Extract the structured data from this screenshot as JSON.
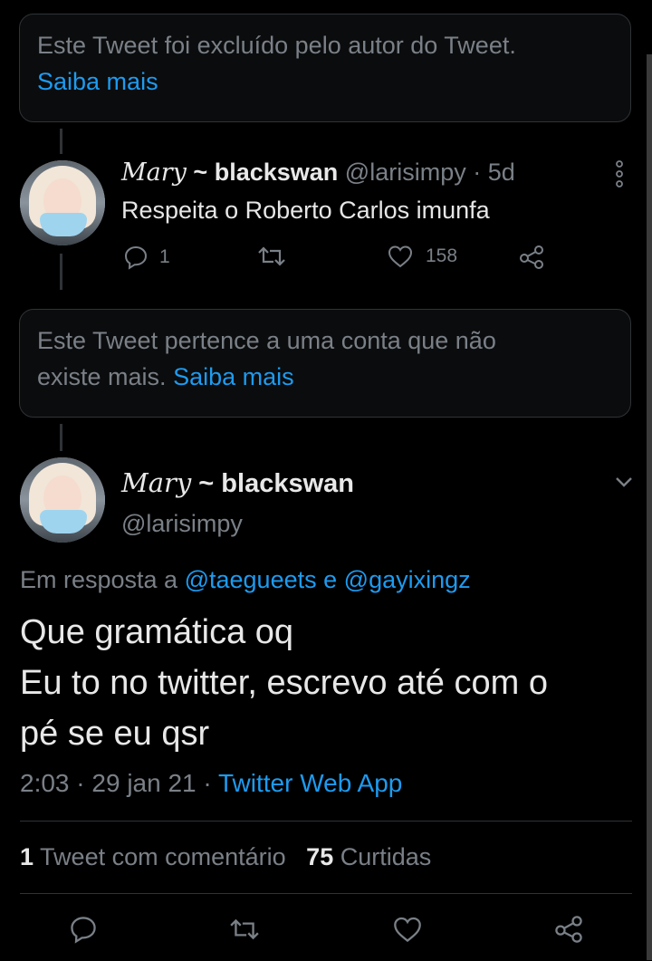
{
  "notices": {
    "deleted": {
      "text": "Este Tweet foi excluído pelo autor do Tweet.",
      "link": "Saiba mais"
    },
    "suspended": {
      "text_line1": "Este Tweet pertence a uma conta que não",
      "text_line2": "existe mais.",
      "link": "Saiba mais"
    }
  },
  "reply_tweet": {
    "display_name": "Mary",
    "display_name_bold": "blackswan",
    "handle": "@larisimpy",
    "separator": "·",
    "time": "5d",
    "text": "Respeita o Roberto Carlos imunfa",
    "reply_count": "1",
    "retweet_count": "",
    "like_count": "158"
  },
  "main_tweet": {
    "display_name": "Mary",
    "display_name_bold": "blackswan",
    "handle": "@larisimpy",
    "reply_prefix": "Em resposta a",
    "reply_user1": "@taegueets",
    "reply_conj": "e",
    "reply_user2": "@gayixingz",
    "text_lines": [
      "Que gramática oq",
      "Eu to no twitter, escrevo até com o",
      "pé se eu qsr"
    ],
    "time": "2:03",
    "sep1": "·",
    "date": "29 jan 21",
    "sep2": "·",
    "source": "Twitter Web App",
    "quote_count": "1",
    "quote_label": "Tweet com comentário",
    "like_count": "75",
    "like_label": "Curtidas"
  },
  "icons": {
    "reply": "reply-icon",
    "retweet": "retweet-icon",
    "like": "heart-icon",
    "share": "share-icon",
    "more": "more-vertical-icon",
    "caret": "chevron-down-icon"
  },
  "colors": {
    "background": "#000000",
    "link": "#1d9bf0",
    "muted": "#7a8087",
    "border": "#2f3336"
  }
}
